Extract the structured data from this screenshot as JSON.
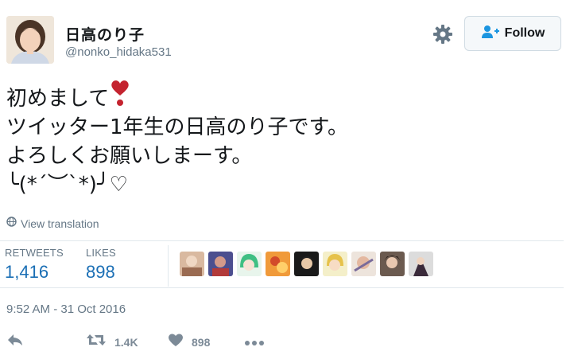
{
  "user": {
    "name": "日高のり子",
    "handle": "@nonko_hidaka531",
    "follow_label": "Follow"
  },
  "tweet": {
    "lines": [
      "初めまして",
      "ツイッター1年生の日高のり子です。",
      "よろしくお願いしまーす。",
      "╰(*´︶`*)╯♡"
    ],
    "translate_label": "View translation"
  },
  "stats": {
    "retweets_label": "RETWEETS",
    "retweets_value": "1,416",
    "likes_label": "LIKES",
    "likes_value": "898"
  },
  "timestamp": "9:52 AM - 31 Oct 2016",
  "actions": {
    "retweet_count": "1.4K",
    "like_count": "898"
  },
  "colors": {
    "accent": "#1b6fb5",
    "muted": "#657786",
    "heart": "#c4232f",
    "divider": "#e1e8ed"
  },
  "icons": [
    "gear-icon",
    "follow-person-icon",
    "heart-emoji-icon",
    "globe-icon",
    "reply-icon",
    "retweet-icon",
    "like-icon",
    "more-icon"
  ]
}
